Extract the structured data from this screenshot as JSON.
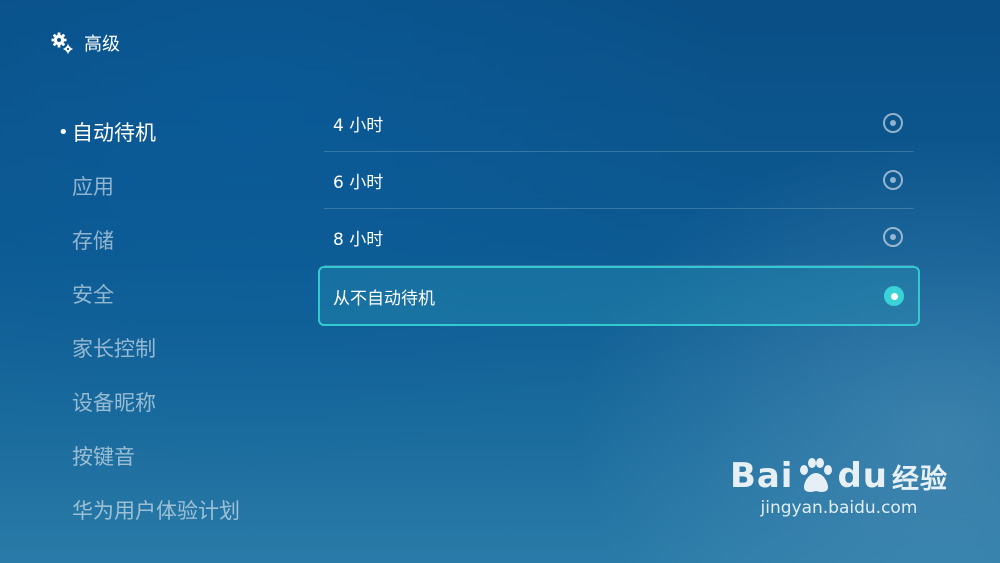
{
  "header": {
    "icon": "gear-icon",
    "title": "高级"
  },
  "menu": {
    "items": [
      {
        "label": "自动待机",
        "bullet": "•",
        "active": true
      },
      {
        "label": "应用"
      },
      {
        "label": "存储"
      },
      {
        "label": "安全"
      },
      {
        "label": "家长控制"
      },
      {
        "label": "设备昵称"
      },
      {
        "label": "按键音"
      },
      {
        "label": "华为用户体验计划"
      }
    ]
  },
  "options": [
    {
      "label": "4 小时",
      "selected": false
    },
    {
      "label": "6 小时",
      "selected": false
    },
    {
      "label": "8 小时",
      "selected": false
    },
    {
      "label": "从不自动待机",
      "selected": true
    }
  ],
  "colors": {
    "accent": "#34c8d0",
    "radio_selected": "#39d2d8"
  },
  "watermark": {
    "brand_left": "Bai",
    "brand_right": "du",
    "brand_cn": "经验",
    "url": "jingyan.baidu.com"
  }
}
